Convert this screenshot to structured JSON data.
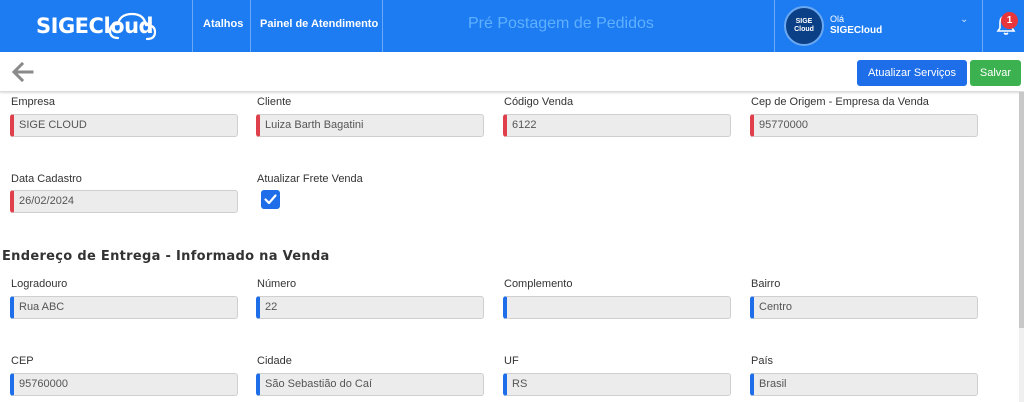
{
  "header": {
    "logo_text": "SIGE",
    "logo_text_2": "Cloud",
    "nav": [
      "Atalhos",
      "Painel de Atendimento"
    ],
    "page_title": "Pré Postagem de Pedidos",
    "user": {
      "avatar_line1": "SIGE",
      "avatar_line2": "Cloud",
      "greeting": "Olá",
      "name": "SIGECloud"
    },
    "notifications_count": "1"
  },
  "toolbar": {
    "update_services_label": "Atualizar Serviços",
    "save_label": "Salvar"
  },
  "form": {
    "empresa": {
      "label": "Empresa",
      "value": "SIGE CLOUD"
    },
    "cliente": {
      "label": "Cliente",
      "value": "Luiza Barth Bagatini"
    },
    "codigo_venda": {
      "label": "Código Venda",
      "value": "6122"
    },
    "cep_origem": {
      "label": "Cep de Origem - Empresa da Venda",
      "value": "95770000"
    },
    "data_cadastro": {
      "label": "Data Cadastro",
      "value": "26/02/2024"
    },
    "atualizar_frete": {
      "label": "Atualizar Frete Venda",
      "checked": true
    }
  },
  "entrega": {
    "section_title": "Endereço de Entrega - Informado na Venda",
    "logradouro": {
      "label": "Logradouro",
      "value": "Rua ABC"
    },
    "numero": {
      "label": "Número",
      "value": "22"
    },
    "complemento": {
      "label": "Complemento",
      "value": ""
    },
    "bairro": {
      "label": "Bairro",
      "value": "Centro"
    },
    "cep": {
      "label": "CEP",
      "value": "95760000"
    },
    "cidade": {
      "label": "Cidade",
      "value": "São Sebastião do Caí"
    },
    "uf": {
      "label": "UF",
      "value": "RS"
    },
    "pais": {
      "label": "País",
      "value": "Brasil"
    }
  },
  "colors": {
    "header_bg": "#1d7cf2",
    "primary_button": "#1d6ee8",
    "save_button": "#3cb150",
    "required_marker": "#e0404c",
    "badge": "#e8363a"
  },
  "icons": [
    "back-arrow-icon",
    "cloud-icon",
    "chevron-down-icon",
    "bell-icon",
    "checkmark-icon"
  ]
}
